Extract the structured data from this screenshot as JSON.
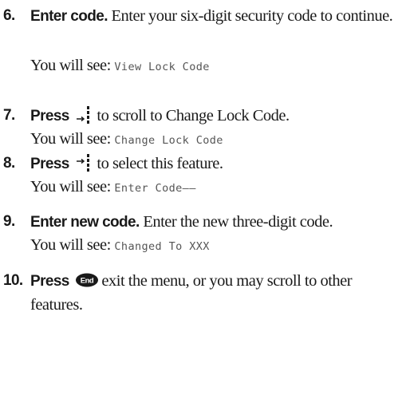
{
  "steps": [
    {
      "number": "6.",
      "lead": "Enter code.",
      "text": " Enter your six-digit security code to continue.",
      "see_label": "You will see:",
      "screen": "View Lock Code"
    },
    {
      "number": "7.",
      "lead": "Press",
      "icon": "scroll-down-key-icon",
      "text": "to scroll to Change Lock Code.",
      "see_label": "You will see:",
      "screen": "Change Lock Code"
    },
    {
      "number": "8.",
      "lead": "Press",
      "icon": "select-key-icon",
      "text": "to select this feature.",
      "see_label": "You will see:",
      "screen": "Enter Code——"
    },
    {
      "number": "9.",
      "lead": "Enter new code.",
      "text": " Enter the new three-digit code.",
      "see_label": "You will see:",
      "screen": "Changed To XXX"
    },
    {
      "number": "10.",
      "lead": "Press",
      "icon": "end-key-icon",
      "icon_label": "End",
      "text": "exit the menu, or you may scroll to other features."
    }
  ]
}
